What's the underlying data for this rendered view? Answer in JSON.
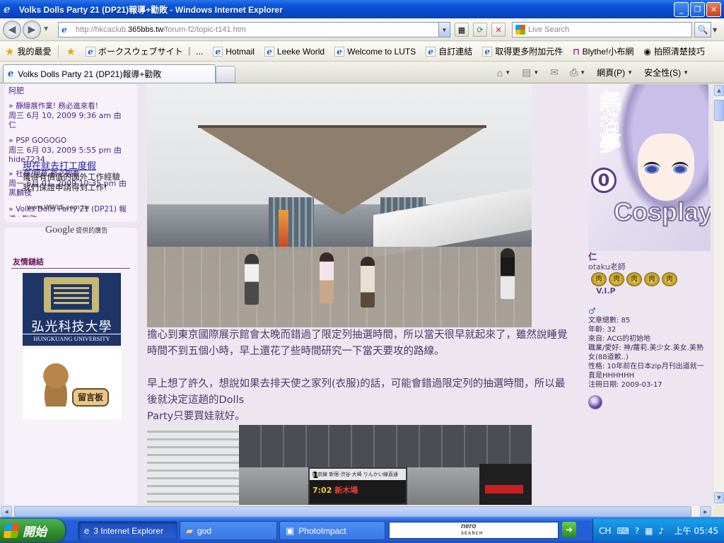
{
  "window": {
    "title": "Volks Dolls Party 21 (DP21)報導+勸敗 - Windows Internet Explorer",
    "minimize": "_",
    "maximize": "❐",
    "close": "✕"
  },
  "address": {
    "url_prefix": "http://hkcaclub.",
    "url_domain": "365bbs.tw",
    "url_path": "/forum-f2/topic-t141.htm",
    "search_placeholder": "Live Search"
  },
  "favorites": {
    "label": "我的最愛",
    "items": [
      "ボークスウェブサイト ｜ ...",
      "Hotmail",
      "Leeke World",
      "Welcome to LUTS",
      "自訂連結",
      "取得更多附加元件",
      "Blythe!小布網",
      "拍照清楚技巧"
    ]
  },
  "tabs": {
    "active_tab": "Volks Dolls Party 21 (DP21)報導+勸敗",
    "web_page": "網頁(P)",
    "safety": "安全性(S)"
  },
  "sidebar": {
    "recent_top": "阿肥",
    "recent": [
      {
        "title": "靜線展作業! 務必進來看!",
        "meta": "周三 6月 10, 2009 9:36 am 由 仁"
      },
      {
        "title": "PSP GOGOGO",
        "meta": "周三 6月 03, 2009 5:55 pm 由 hide7234"
      },
      {
        "title": "社務/規章,務必觀看",
        "meta": "周一 6月 01, 2009 10:35 pm 由 黑麟夜"
      },
      {
        "title": "Volks Dolls Party 21 (DP21) 報導+勸敗",
        "meta": ""
      }
    ],
    "ad": {
      "title": "現在就去打工度假",
      "body": "獲得有價值的國外工作經驗 我們保證申請得到工作!",
      "url": "www.WWLS.com.tw",
      "google": "Google",
      "google_suffix": "提供的廣告"
    },
    "links_title": "友情鏈結",
    "uni_cn": "弘光科技大學",
    "uni_en": "HUNGKUANG UNIVERSITY",
    "guestbook": "留言板"
  },
  "post": {
    "para1": "擔心到東京國際展示館會太晚而錯過了限定列抽選時間，所以當天很早就起來了，雖然說睡覺時間不到五個小時，早上還花了些時間研究一下當天要攻的路線。",
    "para2a": "早上想了許久，想說如果去排天使之家列(衣服)的話，可能會錯過限定列的抽選時間，所以最後就決定這趟的Dolls",
    "para2b": "Party只要買娃就好。",
    "board_num": "1",
    "board_line": "7:02",
    "board_dest": "新木場",
    "board_top": "臨京線 新宿·渋谷·大崎 りんかい線直通"
  },
  "user": {
    "avatar_vertical": "無名夢",
    "avatar_circle": "0",
    "avatar_word": "Cosplay",
    "name": "仁",
    "rank": "otaku老師",
    "medal": "肉",
    "vip": "V.I.P",
    "gender_icon": "♂",
    "stats": [
      "文章總數: 85",
      "年齡: 32",
      "來自: ACG的初始地",
      "職業/愛好: 神/蘿莉.美少女.美女.美熟女(88道歉..)",
      "性格: 10年前在日本zip月刊出道就一直是HHHHHH",
      "注冊日期: 2009-03-17"
    ]
  },
  "taskbar": {
    "start": "開始",
    "ie": "3 Internet Explorer",
    "folder": "god",
    "photoimpact": "PhotoImpact",
    "nero": "nero",
    "nero_sub": "SEARCH",
    "lang": "CH",
    "clock": "上午 05:45"
  },
  "colors": {
    "page_bg": "#EDE5F0",
    "panel_bg": "#F7F2F9",
    "text_purple": "#4a3a6a"
  }
}
